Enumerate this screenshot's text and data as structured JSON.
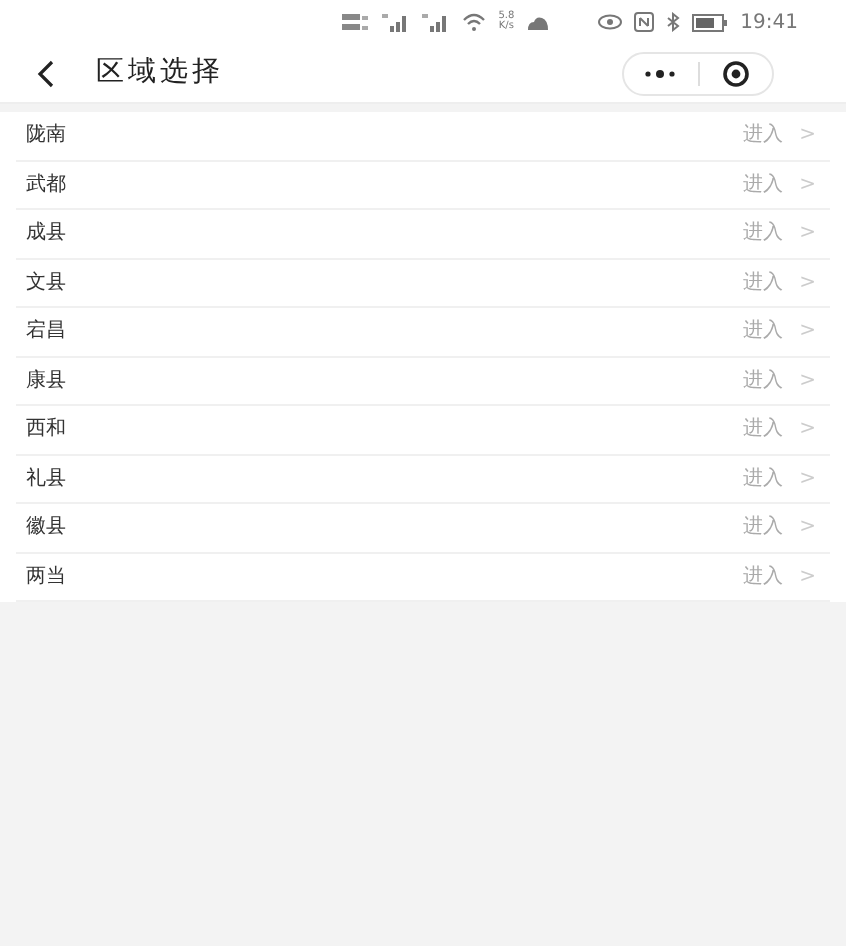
{
  "status_bar": {
    "speed_value": "5.8",
    "speed_unit": "K/s",
    "time": "19:41"
  },
  "nav_bar": {
    "title": "区域选择"
  },
  "regions": [
    {
      "name": "陇南",
      "action": "进入",
      "arrow": ">"
    },
    {
      "name": "武都",
      "action": "进入",
      "arrow": ">"
    },
    {
      "name": "成县",
      "action": "进入",
      "arrow": ">"
    },
    {
      "name": "文县",
      "action": "进入",
      "arrow": ">"
    },
    {
      "name": "宕昌",
      "action": "进入",
      "arrow": ">"
    },
    {
      "name": "康县",
      "action": "进入",
      "arrow": ">"
    },
    {
      "name": "西和",
      "action": "进入",
      "arrow": ">"
    },
    {
      "name": "礼县",
      "action": "进入",
      "arrow": ">"
    },
    {
      "name": "徽县",
      "action": "进入",
      "arrow": ">"
    },
    {
      "name": "两当",
      "action": "进入",
      "arrow": ">"
    }
  ]
}
